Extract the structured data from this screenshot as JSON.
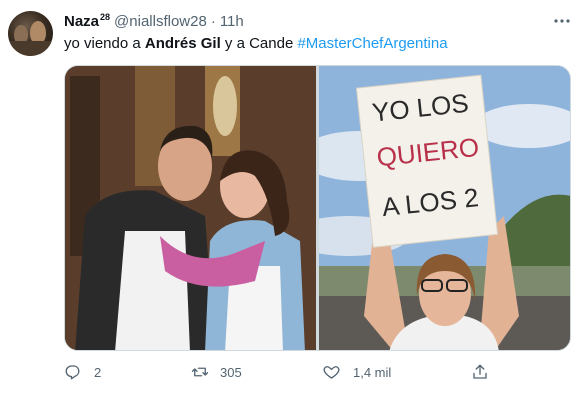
{
  "tweet": {
    "author": {
      "display_name": "Naza",
      "name_suffix": "28",
      "handle": "@niallsflow28",
      "separator": "·",
      "time": "11h",
      "avatar_icon": "avatar-photo"
    },
    "text_parts": {
      "p1": "yo viendo a ",
      "bold1": "Andrés Gil",
      "p2": " y a Cande ",
      "hashtag": "#MasterChefArgentina"
    },
    "media": {
      "left_photo_icon": "photo-couple-embracing",
      "right_photo_icon": "photo-woman-holding-sign",
      "sign_lines": [
        "YO LOS",
        "QUIERO",
        "A LOS 2"
      ]
    },
    "actions": {
      "reply_count": "2",
      "retweet_count": "305",
      "like_count": "1,4 mil",
      "reply_icon": "reply-icon",
      "retweet_icon": "retweet-icon",
      "like_icon": "heart-icon",
      "share_icon": "share-icon",
      "more_icon": "more-icon"
    },
    "colors": {
      "accent": "#1d9bf0",
      "secondary_text": "#536471",
      "primary_text": "#0f1419"
    }
  }
}
